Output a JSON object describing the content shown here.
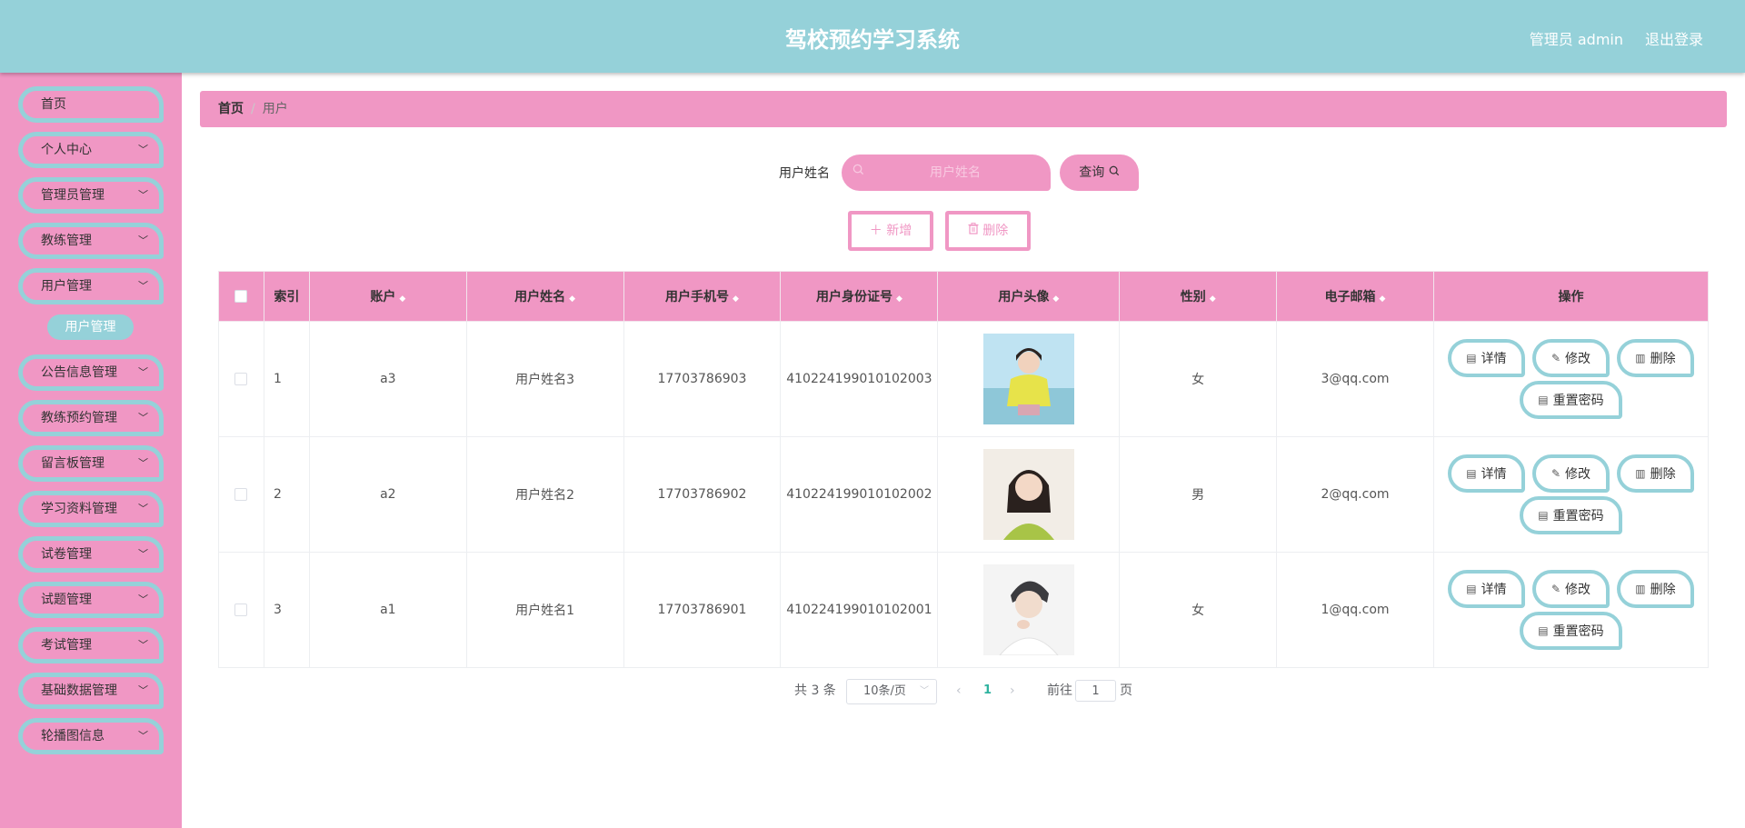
{
  "header": {
    "title": "驾校预约学习系统",
    "user": "管理员 admin",
    "logout": "退出登录"
  },
  "sidebar": {
    "items": [
      {
        "label": "首页",
        "has_children": false
      },
      {
        "label": "个人中心",
        "has_children": true
      },
      {
        "label": "管理员管理",
        "has_children": true
      },
      {
        "label": "教练管理",
        "has_children": true
      },
      {
        "label": "用户管理",
        "has_children": true
      },
      {
        "label": "公告信息管理",
        "has_children": true
      },
      {
        "label": "教练预约管理",
        "has_children": true
      },
      {
        "label": "留言板管理",
        "has_children": true
      },
      {
        "label": "学习资料管理",
        "has_children": true
      },
      {
        "label": "试卷管理",
        "has_children": true
      },
      {
        "label": "试题管理",
        "has_children": true
      },
      {
        "label": "考试管理",
        "has_children": true
      },
      {
        "label": "基础数据管理",
        "has_children": true
      },
      {
        "label": "轮播图信息",
        "has_children": true
      }
    ],
    "active_submenu": "用户管理"
  },
  "breadcrumb": {
    "home": "首页",
    "current": "用户"
  },
  "search": {
    "label": "用户姓名",
    "placeholder": "用户姓名",
    "button": "查询"
  },
  "actions": {
    "add": "新增",
    "delete": "删除"
  },
  "table": {
    "columns": [
      "索引",
      "账户",
      "用户姓名",
      "用户手机号",
      "用户身份证号",
      "用户头像",
      "性别",
      "电子邮箱",
      "操作"
    ],
    "rows": [
      {
        "index": "1",
        "account": "a3",
        "name": "用户姓名3",
        "phone": "17703786903",
        "id_card": "410224199010102003",
        "gender": "女",
        "email": "3@qq.com"
      },
      {
        "index": "2",
        "account": "a2",
        "name": "用户姓名2",
        "phone": "17703786902",
        "id_card": "410224199010102002",
        "gender": "男",
        "email": "2@qq.com"
      },
      {
        "index": "3",
        "account": "a1",
        "name": "用户姓名1",
        "phone": "17703786901",
        "id_card": "410224199010102001",
        "gender": "女",
        "email": "1@qq.com"
      }
    ],
    "row_actions": {
      "detail": "详情",
      "edit": "修改",
      "delete": "删除",
      "reset_password": "重置密码"
    }
  },
  "pagination": {
    "total": "共 3 条",
    "page_size": "10条/页",
    "current_page": "1",
    "goto_prefix": "前往",
    "goto_value": "1",
    "goto_suffix": "页"
  },
  "colors": {
    "header": "#95d1d9",
    "sidebar": "#f097c4",
    "accent_border": "#95d1d9",
    "pink": "#f097c4",
    "page_active": "#2fb39f"
  }
}
